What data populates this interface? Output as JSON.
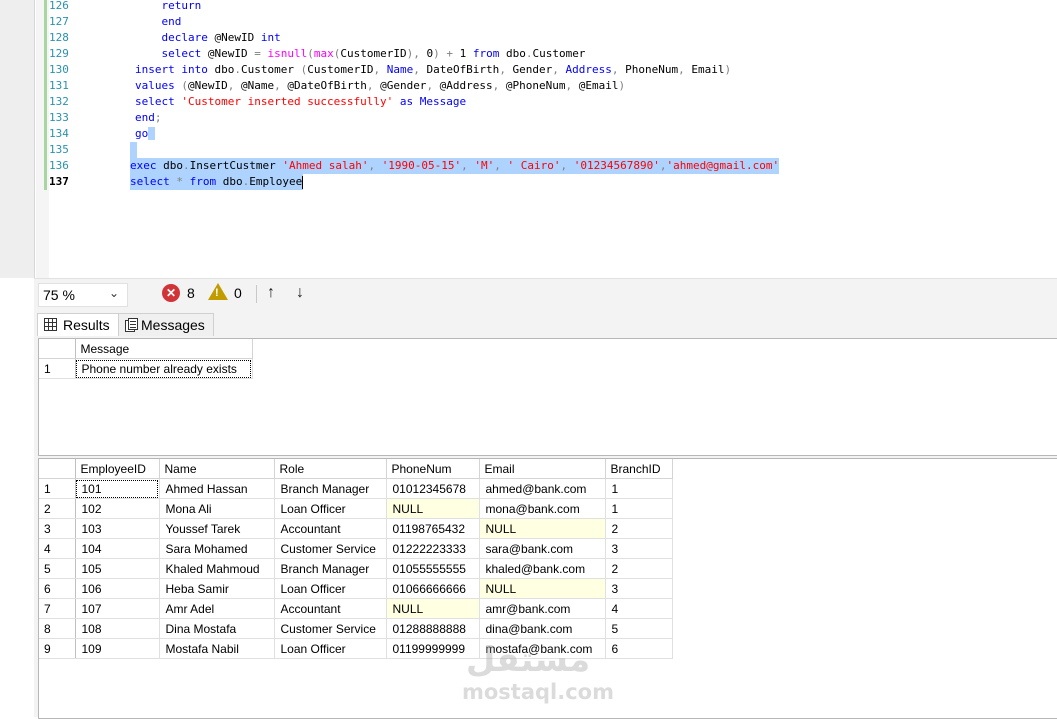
{
  "editor": {
    "lines": [
      {
        "num": "126",
        "segments": [
          {
            "t": "            "
          },
          {
            "t": "return",
            "c": "kw"
          }
        ]
      },
      {
        "num": "127",
        "segments": [
          {
            "t": "            "
          },
          {
            "t": "end",
            "c": "kw"
          }
        ]
      },
      {
        "num": "128",
        "segments": [
          {
            "t": "            "
          },
          {
            "t": "declare",
            "c": "kw"
          },
          {
            "t": " @NewID "
          },
          {
            "t": "int",
            "c": "kw"
          }
        ]
      },
      {
        "num": "129",
        "segments": [
          {
            "t": "            "
          },
          {
            "t": "select",
            "c": "kw"
          },
          {
            "t": " @NewID "
          },
          {
            "t": "=",
            "c": "gr"
          },
          {
            "t": " "
          },
          {
            "t": "isnull",
            "c": "fn"
          },
          {
            "t": "(",
            "c": "gr"
          },
          {
            "t": "max",
            "c": "fn"
          },
          {
            "t": "(",
            "c": "gr"
          },
          {
            "t": "CustomerID"
          },
          {
            "t": "),",
            "c": "gr"
          },
          {
            "t": " 0"
          },
          {
            "t": ")",
            "c": "gr"
          },
          {
            "t": " "
          },
          {
            "t": "+",
            "c": "gr"
          },
          {
            "t": " 1 "
          },
          {
            "t": "from",
            "c": "kw"
          },
          {
            "t": " dbo"
          },
          {
            "t": ".",
            "c": "gr"
          },
          {
            "t": "Customer"
          }
        ]
      },
      {
        "num": "130",
        "segments": [
          {
            "t": "        "
          },
          {
            "t": "insert",
            "c": "kw"
          },
          {
            "t": " "
          },
          {
            "t": "into",
            "c": "kw"
          },
          {
            "t": " dbo"
          },
          {
            "t": ".",
            "c": "gr"
          },
          {
            "t": "Customer "
          },
          {
            "t": "(",
            "c": "gr"
          },
          {
            "t": "CustomerID"
          },
          {
            "t": ",",
            "c": "gr"
          },
          {
            "t": " "
          },
          {
            "t": "Name",
            "c": "kw"
          },
          {
            "t": ",",
            "c": "gr"
          },
          {
            "t": " DateOfBirth"
          },
          {
            "t": ",",
            "c": "gr"
          },
          {
            "t": " Gender"
          },
          {
            "t": ",",
            "c": "gr"
          },
          {
            "t": " "
          },
          {
            "t": "Address",
            "c": "kw"
          },
          {
            "t": ",",
            "c": "gr"
          },
          {
            "t": " PhoneNum"
          },
          {
            "t": ",",
            "c": "gr"
          },
          {
            "t": " Email"
          },
          {
            "t": ")",
            "c": "gr"
          }
        ]
      },
      {
        "num": "131",
        "segments": [
          {
            "t": "        "
          },
          {
            "t": "values",
            "c": "kw"
          },
          {
            "t": " "
          },
          {
            "t": "(",
            "c": "gr"
          },
          {
            "t": "@NewID"
          },
          {
            "t": ",",
            "c": "gr"
          },
          {
            "t": " @Name"
          },
          {
            "t": ",",
            "c": "gr"
          },
          {
            "t": " @DateOfBirth"
          },
          {
            "t": ",",
            "c": "gr"
          },
          {
            "t": " @Gender"
          },
          {
            "t": ",",
            "c": "gr"
          },
          {
            "t": " @Address"
          },
          {
            "t": ",",
            "c": "gr"
          },
          {
            "t": " @PhoneNum"
          },
          {
            "t": ",",
            "c": "gr"
          },
          {
            "t": " @Email"
          },
          {
            "t": ")",
            "c": "gr"
          }
        ]
      },
      {
        "num": "132",
        "segments": [
          {
            "t": "        "
          },
          {
            "t": "select",
            "c": "kw"
          },
          {
            "t": " "
          },
          {
            "t": "'Customer inserted successfully'",
            "c": "str"
          },
          {
            "t": " "
          },
          {
            "t": "as",
            "c": "kw"
          },
          {
            "t": " "
          },
          {
            "t": "Message",
            "c": "kw"
          }
        ]
      },
      {
        "num": "133",
        "segments": [
          {
            "t": "        "
          },
          {
            "t": "end",
            "c": "kw"
          },
          {
            "t": ";",
            "c": "gr"
          }
        ]
      },
      {
        "num": "134",
        "segments": [
          {
            "t": "        "
          },
          {
            "t": "go",
            "c": "kw"
          }
        ]
      },
      {
        "num": "135",
        "segments": []
      },
      {
        "num": "136",
        "segments": [
          {
            "t": "exec",
            "c": "kw"
          },
          {
            "t": " dbo"
          },
          {
            "t": ".",
            "c": "gr"
          },
          {
            "t": "InsertCustmer "
          },
          {
            "t": "'Ahmed salah'",
            "c": "str"
          },
          {
            "t": ",",
            "c": "gr"
          },
          {
            "t": " "
          },
          {
            "t": "'1990-05-15'",
            "c": "str"
          },
          {
            "t": ",",
            "c": "gr"
          },
          {
            "t": " "
          },
          {
            "t": "'M'",
            "c": "str"
          },
          {
            "t": ",",
            "c": "gr"
          },
          {
            "t": " "
          },
          {
            "t": "' Cairo'",
            "c": "str"
          },
          {
            "t": ",",
            "c": "gr"
          },
          {
            "t": " "
          },
          {
            "t": "'01234567890'",
            "c": "str"
          },
          {
            "t": ",",
            "c": "gr"
          },
          {
            "t": "'ahmed@gmail.com'",
            "c": "str"
          }
        ]
      },
      {
        "num": "137",
        "current": true,
        "segments": [
          {
            "t": "select",
            "c": "kw"
          },
          {
            "t": " "
          },
          {
            "t": "*",
            "c": "gr"
          },
          {
            "t": " "
          },
          {
            "t": "from",
            "c": "kw"
          },
          {
            "t": " dbo"
          },
          {
            "t": ".",
            "c": "gr"
          },
          {
            "t": "Employee"
          }
        ]
      }
    ]
  },
  "status": {
    "zoom": "75 %",
    "errors": "8",
    "warnings": "0",
    "up_arrow": "↑",
    "down_arrow": "↓"
  },
  "tabs": {
    "results": "Results",
    "messages": "Messages"
  },
  "grid1": {
    "columns": [
      "Message"
    ],
    "rows": [
      [
        "1",
        "Phone number already exists"
      ]
    ]
  },
  "grid2": {
    "columns": [
      "EmployeeID",
      "Name",
      "Role",
      "PhoneNum",
      "Email",
      "BranchID"
    ],
    "rows": [
      [
        "1",
        "101",
        "Ahmed Hassan",
        "Branch Manager",
        "01012345678",
        "ahmed@bank.com",
        "1"
      ],
      [
        "2",
        "102",
        "Mona Ali",
        "Loan Officer",
        "NULL",
        "mona@bank.com",
        "1"
      ],
      [
        "3",
        "103",
        "Youssef Tarek",
        "Accountant",
        "01198765432",
        "NULL",
        "2"
      ],
      [
        "4",
        "104",
        "Sara Mohamed",
        "Customer Service",
        "01222223333",
        "sara@bank.com",
        "3"
      ],
      [
        "5",
        "105",
        "Khaled Mahmoud",
        "Branch Manager",
        "01055555555",
        "khaled@bank.com",
        "2"
      ],
      [
        "6",
        "106",
        "Heba Samir",
        "Loan Officer",
        "01066666666",
        "NULL",
        "3"
      ],
      [
        "7",
        "107",
        "Amr Adel",
        "Accountant",
        "NULL",
        "amr@bank.com",
        "4"
      ],
      [
        "8",
        "108",
        "Dina Mostafa",
        "Customer Service",
        "01288888888",
        "dina@bank.com",
        "5"
      ],
      [
        "9",
        "109",
        "Mostafa Nabil",
        "Loan Officer",
        "01199999999",
        "mostafa@bank.com",
        "6"
      ]
    ]
  },
  "watermark": {
    "arabic": "مستقل",
    "latin": "mostaql.com"
  },
  "colors": {
    "selection": "#aed3ff",
    "keyword": "#0000ff",
    "string": "#ff0000",
    "function": "#ff00ff",
    "null_cell": "#ffffe1",
    "error": "#d13438",
    "warning": "#c19c00"
  }
}
